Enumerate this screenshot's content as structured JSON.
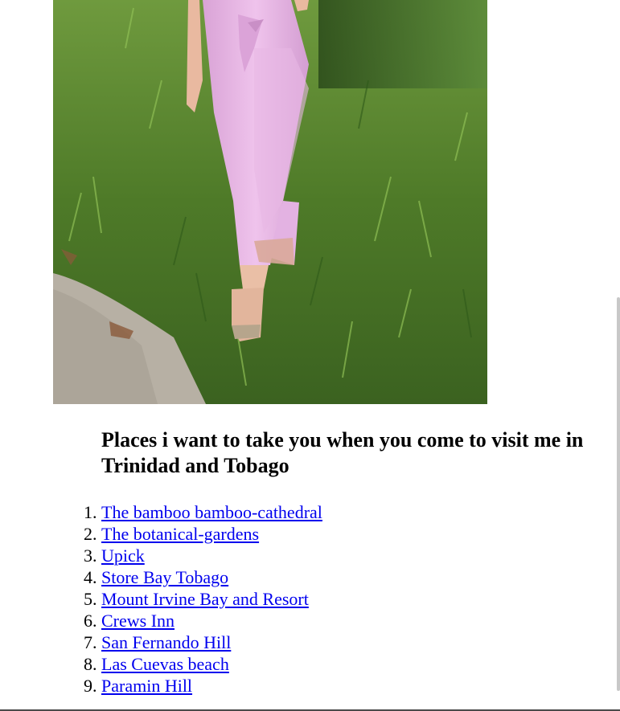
{
  "photo": {
    "alt": "Woman in pink trousers and sandals standing on grass"
  },
  "heading": "Places i want to take you when you come to visit me in Trinidad and Tobago",
  "places": [
    {
      "label": "The bamboo bamboo-cathedral"
    },
    {
      "label": "The botanical-gardens"
    },
    {
      "label": "Upick"
    },
    {
      "label": "Store Bay Tobago"
    },
    {
      "label": "Mount Irvine Bay and Resort"
    },
    {
      "label": "Crews Inn"
    },
    {
      "label": "San Fernando Hill"
    },
    {
      "label": "Las Cuevas beach"
    },
    {
      "label": "Paramin Hill"
    }
  ],
  "colors": {
    "link": "#0000ee",
    "grass": "#4f7a2c",
    "pants": "#e3b2e2"
  }
}
